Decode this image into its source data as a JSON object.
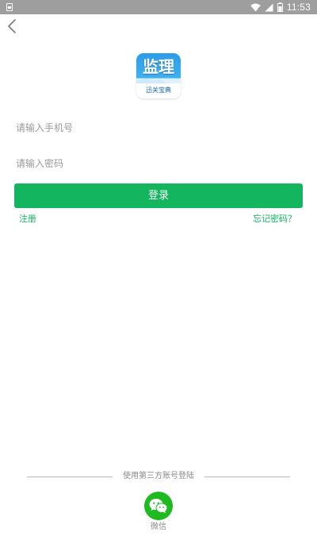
{
  "status_bar": {
    "time": "11:53",
    "icons": [
      "sim-card-icon",
      "wifi-icon",
      "cellular-signal-icon",
      "battery-icon"
    ]
  },
  "nav": {
    "back_icon": "chevron-left-icon"
  },
  "logo": {
    "main_text": "监理",
    "sub_text": "迅关宝典"
  },
  "form": {
    "phone_placeholder": "请输入手机号",
    "phone_value": "",
    "password_placeholder": "请输入密码",
    "password_value": "",
    "login_label": "登录",
    "register_label": "注册",
    "forgot_label": "忘记密码？"
  },
  "third_party": {
    "title": "使用第三方账号登陆",
    "wechat_label": "微信",
    "wechat_icon": "wechat-icon"
  },
  "colors": {
    "accent": "#13b65f",
    "wechat": "#1fb922",
    "status_bar": "#9e9e9e",
    "placeholder": "#9a9a9a"
  }
}
